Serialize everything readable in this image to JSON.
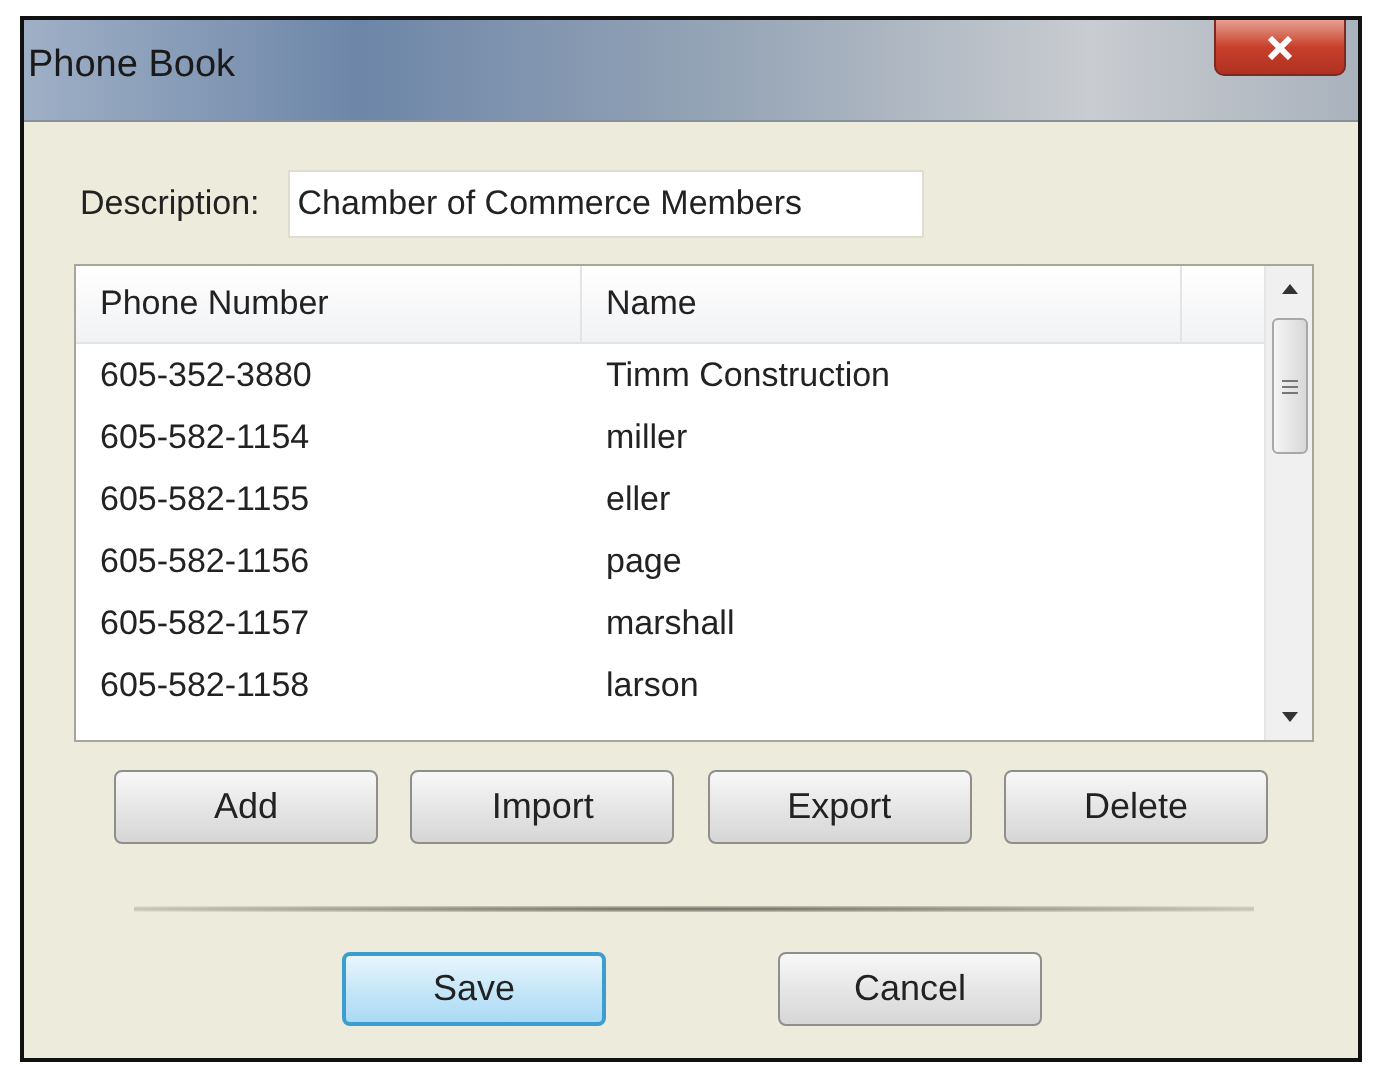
{
  "window": {
    "title": "Phone Book"
  },
  "description": {
    "label": "Description:",
    "value": "Chamber of Commerce Members"
  },
  "table": {
    "columns": [
      "Phone Number",
      "Name"
    ],
    "rows": [
      {
        "phone": "605-352-3880",
        "name": "Timm Construction"
      },
      {
        "phone": "605-582-1154",
        "name": "miller"
      },
      {
        "phone": "605-582-1155",
        "name": "eller"
      },
      {
        "phone": "605-582-1156",
        "name": "page"
      },
      {
        "phone": "605-582-1157",
        "name": "marshall"
      },
      {
        "phone": "605-582-1158",
        "name": "larson"
      }
    ]
  },
  "list_buttons": [
    "Add",
    "Import",
    "Export",
    "Delete"
  ],
  "dialog_buttons": [
    {
      "label": "Save",
      "default": true
    },
    {
      "label": "Cancel",
      "default": false
    }
  ]
}
